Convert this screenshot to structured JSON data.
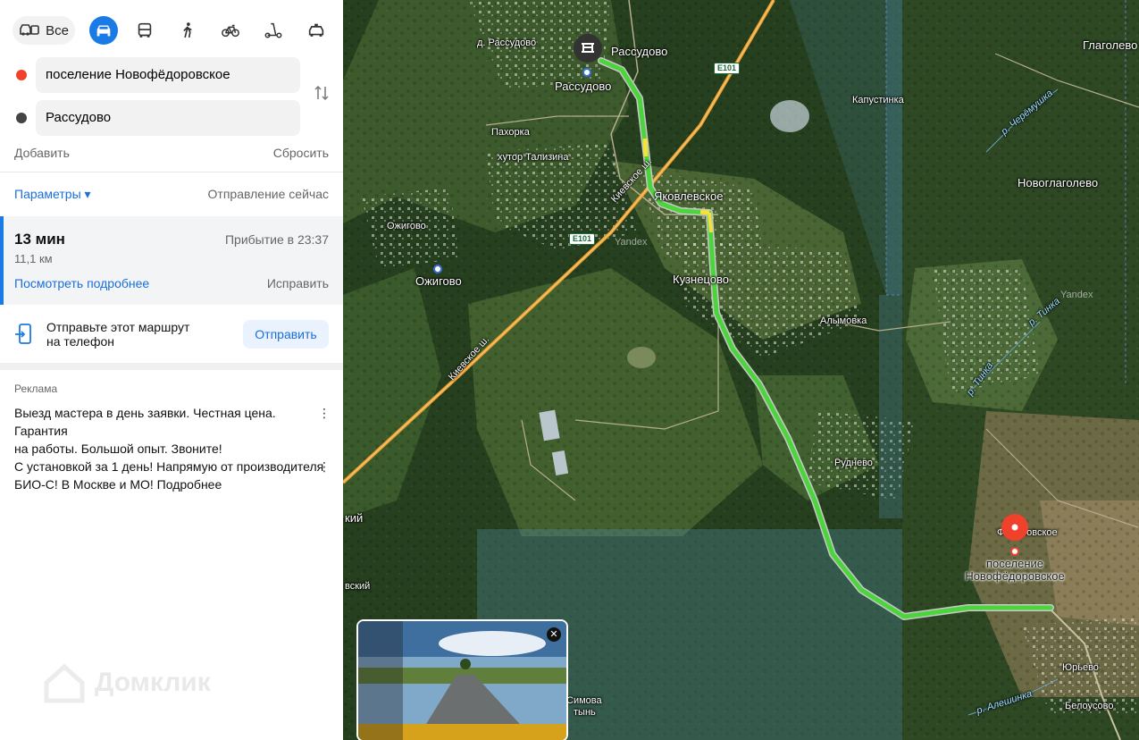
{
  "modes": {
    "all_label": "Все",
    "items": [
      "car-icon",
      "bus-icon",
      "pedestrian-icon",
      "bicycle-icon",
      "scooter-icon",
      "taxi-icon"
    ],
    "active": "car-icon"
  },
  "route": {
    "from": "поселение Новофёдоровское",
    "to": "Рассудово",
    "add_label": "Добавить",
    "reset_label": "Сбросить",
    "params_label": "Параметры ▾",
    "departure_label": "Отправление сейчас"
  },
  "result": {
    "time": "13 мин",
    "distance": "11,1 км",
    "arrival": "Прибытие в 23:37",
    "details_label": "Посмотреть подробнее",
    "fix_label": "Исправить"
  },
  "send": {
    "text_line1": "Отправьте этот маршрут",
    "text_line2": "на телефон",
    "button": "Отправить"
  },
  "ads": {
    "label": "Реклама",
    "ad1_line1": "Выезд мастера в день заявки. Честная цена. Гарантия",
    "ad1_line2": "на работы. Большой опыт. Звоните!",
    "ad2_line1": "С установкой за 1 день! Напрямую от производителя",
    "ad2_line2": "БИО-С! В Москве и МО! Подробнее"
  },
  "watermark": "Домклик",
  "colors": {
    "accent": "#1a7ae6",
    "start_dot": "#f0412c",
    "end_dot": "#444444",
    "route": "#4cd43c",
    "pin": "#f0412c"
  },
  "map": {
    "labels": {
      "d_rassudovo": "д. Рассудово",
      "rassudovo_top": "Рассудово",
      "rassudovo_station": "Рассудово",
      "pakhorka": "Пахорка",
      "khutor": "хутор Тализина",
      "kapustinka": "Капустинка",
      "glagolevo": "Глаголево",
      "novoglagolevo": "Новоглаголево",
      "yakovlevskoe": "Яковлевское",
      "ozhigovo": "Ожигово",
      "ozhigovo_station": "Ожигово",
      "kuznetsovo": "Кузнецово",
      "alymovka": "Алымовка",
      "rudnevo": "Руднево",
      "fedorovskoe": "Фёдоровское",
      "yurevo": "Юрьево",
      "belousovo": "Белоусово",
      "kiy": "кий",
      "vskiy": "вский",
      "simova": "Симова",
      "kytyn": "тынь",
      "kievskoe1": "Киевское ш.",
      "kievskoe2": "Киевское ш.",
      "river_cheremushka": "р. Черёмушка",
      "river_tinka1": "р. Тинка",
      "river_tinka2": "р. Тинка",
      "river_aleshinka": "р. Алешинка",
      "yandex1": "Yandex",
      "yandex2": "Yandex",
      "e101a": "E101",
      "e101b": "E101",
      "destination": "поселение Новофёдоровское"
    }
  }
}
